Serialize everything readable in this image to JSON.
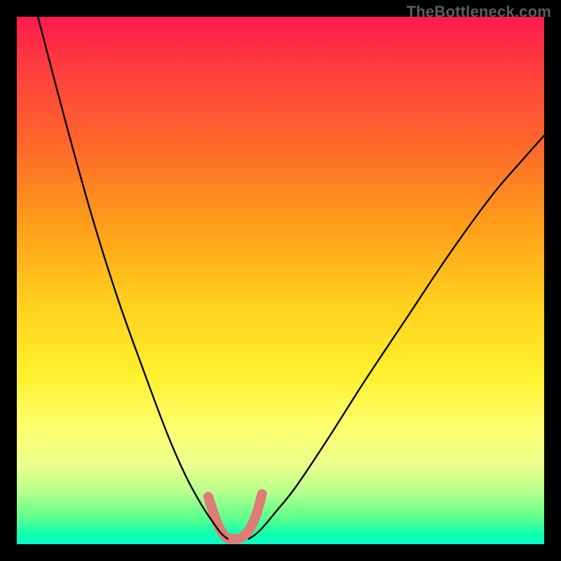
{
  "watermark": "TheBottleneck.com",
  "chart_data": {
    "type": "line",
    "title": "",
    "xlabel": "",
    "ylabel": "",
    "xlim": [
      0,
      1
    ],
    "ylim": [
      0,
      1
    ],
    "note": "Bottleneck curve plot with rainbow gradient background. Y represents bottleneck percentage (top=high bottleneck/red, bottom=low bottleneck/green). X is an unlabeled component balance axis. Two black curves descend to a minimum around x≈0.41; a thick salmon overlay highlights the flat optimum region at the bottom.",
    "series": [
      {
        "name": "left-curve",
        "x": [
          0.04,
          0.09,
          0.14,
          0.19,
          0.24,
          0.285,
          0.32,
          0.35,
          0.373,
          0.388,
          0.4
        ],
        "y": [
          0.0,
          0.19,
          0.37,
          0.53,
          0.67,
          0.79,
          0.87,
          0.925,
          0.96,
          0.98,
          0.99
        ]
      },
      {
        "name": "right-curve",
        "x": [
          0.44,
          0.46,
          0.49,
          0.53,
          0.59,
          0.66,
          0.74,
          0.82,
          0.9,
          0.96,
          1.0
        ],
        "y": [
          0.99,
          0.975,
          0.94,
          0.89,
          0.8,
          0.69,
          0.57,
          0.45,
          0.34,
          0.27,
          0.225
        ]
      },
      {
        "name": "highlight-region",
        "x": [
          0.363,
          0.38,
          0.395,
          0.41,
          0.43,
          0.45,
          0.465
        ],
        "y": [
          0.91,
          0.96,
          0.985,
          0.99,
          0.985,
          0.955,
          0.905
        ]
      }
    ],
    "colors": {
      "curve": "#000000",
      "highlight": "#e07b76",
      "gradient_top": "#ff1a4d",
      "gradient_bottom": "#00ffc5"
    }
  }
}
